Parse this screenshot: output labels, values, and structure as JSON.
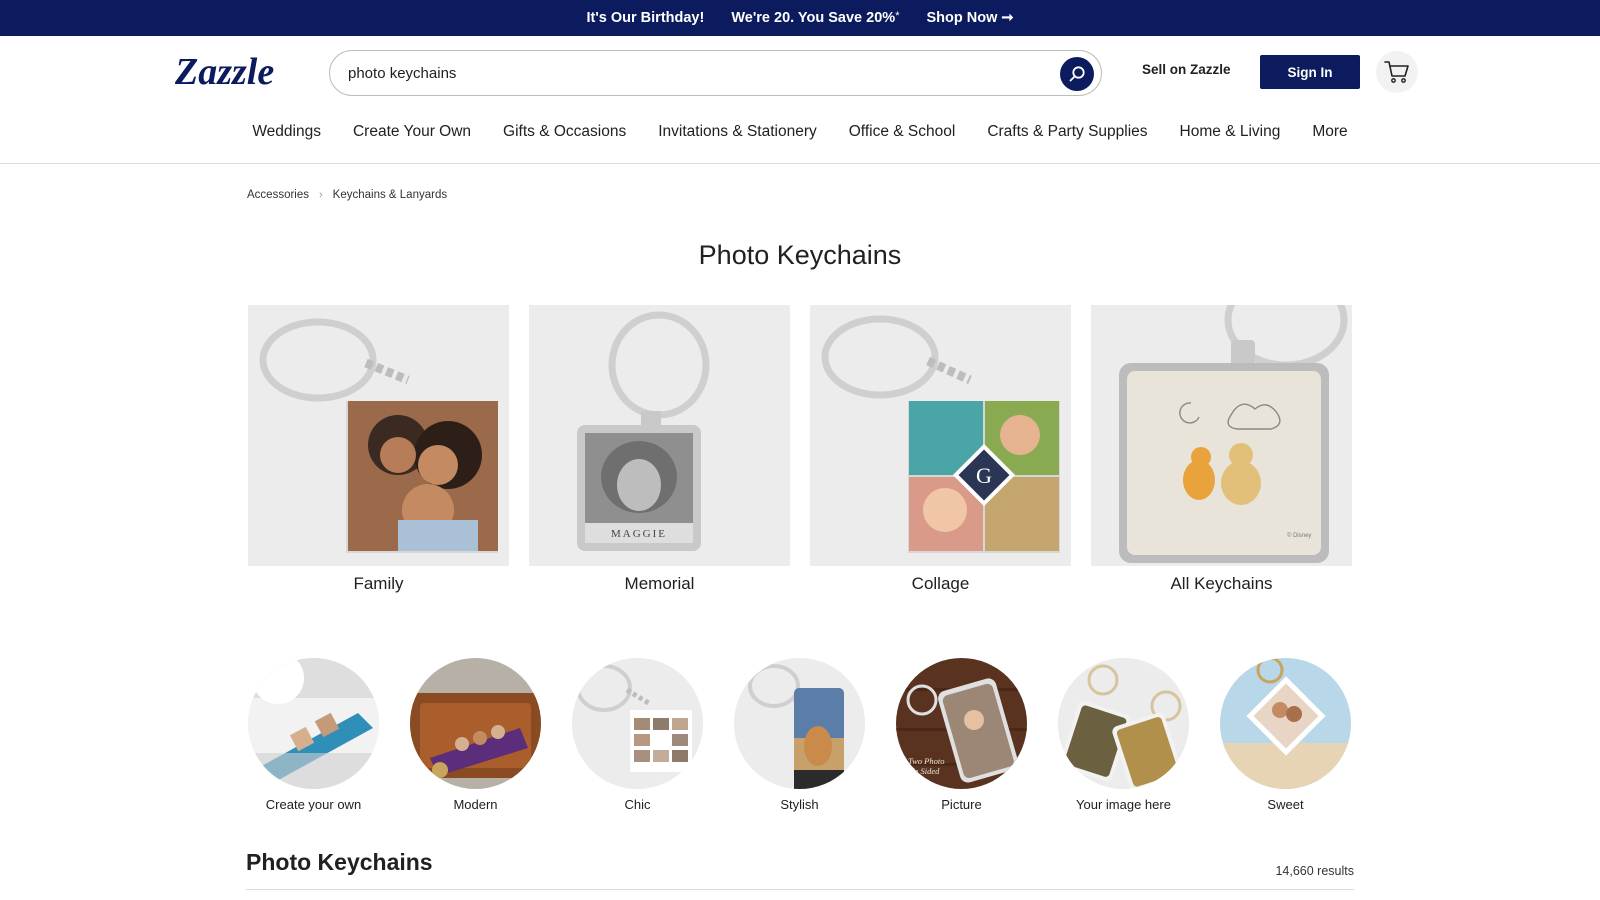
{
  "promo": {
    "birthday": "It's Our Birthday!",
    "save": "We're 20. You Save 20%",
    "save_sup": "*",
    "shop": "Shop Now",
    "shop_arrow": "➞"
  },
  "header": {
    "logo_text": "Zazzle",
    "search_value": "photo keychains",
    "sell": "Sell on Zazzle",
    "sign_in": "Sign In",
    "search_icon": "search-icon",
    "cart_icon": "cart-icon"
  },
  "nav": [
    "Weddings",
    "Create Your Own",
    "Gifts & Occasions",
    "Invitations & Stationery",
    "Office & School",
    "Crafts & Party Supplies",
    "Home & Living",
    "More"
  ],
  "breadcrumb": {
    "items": [
      "Accessories",
      "Keychains & Lanyards"
    ],
    "separator": "›"
  },
  "page_title": "Photo Keychains",
  "categories": [
    {
      "label": "Family"
    },
    {
      "label": "Memorial",
      "tag": "MAGGIE"
    },
    {
      "label": "Collage",
      "tag": "G"
    },
    {
      "label": "All Keychains",
      "tag": "© Disney"
    }
  ],
  "styles": [
    {
      "label": "Create your own"
    },
    {
      "label": "Modern"
    },
    {
      "label": "Chic"
    },
    {
      "label": "Stylish"
    },
    {
      "label": "Picture",
      "tag1": "Two Photo",
      "tag2": "ble Sided"
    },
    {
      "label": "Your image here"
    },
    {
      "label": "Sweet"
    }
  ],
  "results": {
    "title": "Photo Keychains",
    "count": "14,660 results"
  },
  "colors": {
    "brand_navy": "#0c1b5e",
    "card_bg": "#ececec",
    "divider": "#dcdcdc"
  }
}
